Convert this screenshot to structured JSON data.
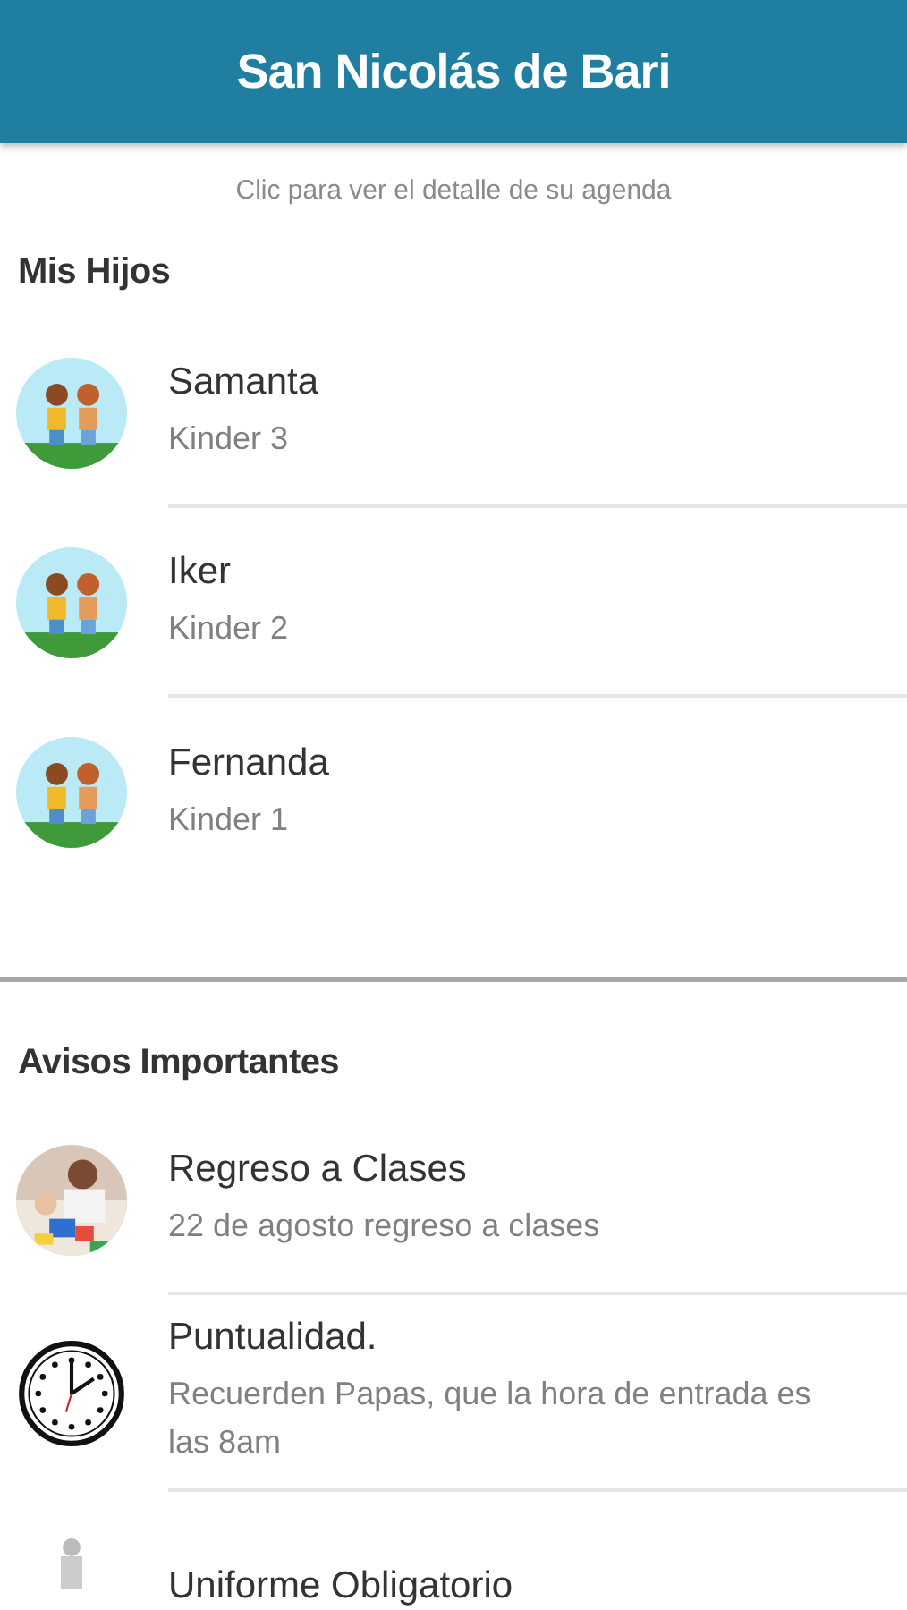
{
  "header": {
    "title": "San Nicolás de Bari"
  },
  "hint": "Clic para ver el detalle de su agenda",
  "children_section": {
    "title": "Mis Hijos",
    "items": [
      {
        "name": "Samanta",
        "grade": "Kinder 3",
        "kind": "kids"
      },
      {
        "name": "Iker",
        "grade": "Kinder 2",
        "kind": "kids"
      },
      {
        "name": "Fernanda",
        "grade": "Kinder 1",
        "kind": "kids"
      }
    ]
  },
  "notices_section": {
    "title": "Avisos Importantes",
    "items": [
      {
        "title": "Regreso a Clases",
        "text": "22 de agosto regreso a clases"
      },
      {
        "title": "Puntualidad.",
        "text": "Recuerden Papas, que la hora de entrada es las 8am",
        "kind": "clock"
      },
      {
        "title": "Uniforme Obligatorio",
        "kind": "figure"
      }
    ]
  }
}
